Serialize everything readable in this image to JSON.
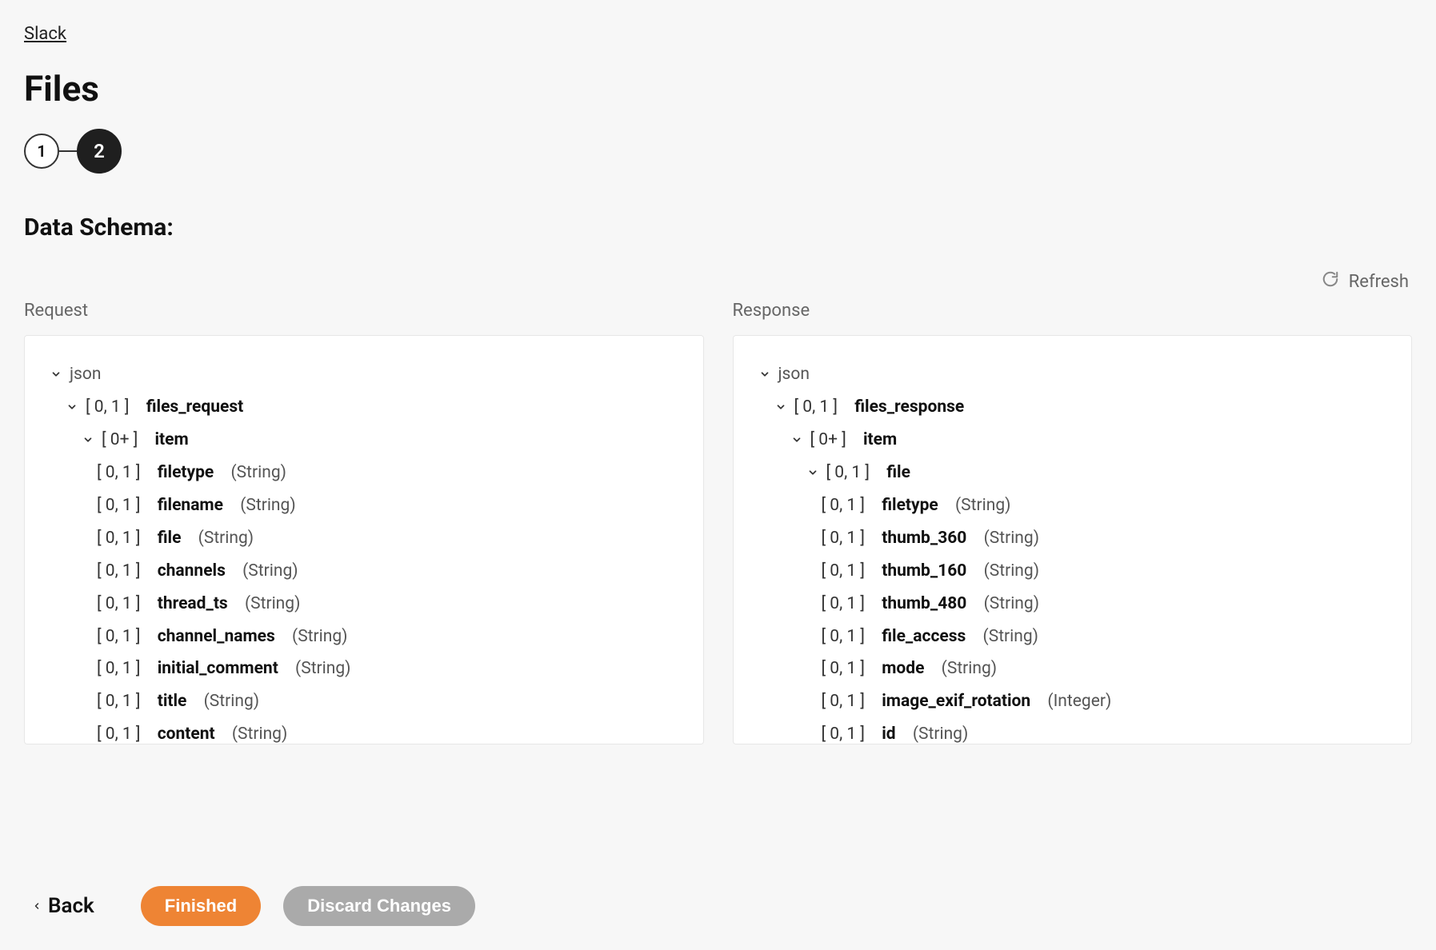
{
  "breadcrumb": "Slack",
  "title": "Files",
  "stepper": {
    "step1": "1",
    "step2": "2"
  },
  "section_title": "Data Schema:",
  "refresh_label": "Refresh",
  "columns": {
    "request_header": "Request",
    "response_header": "Response"
  },
  "tree": {
    "root_label": "json",
    "request": {
      "card": "[ 0, 1 ]",
      "name": "files_request",
      "item": {
        "card": "[ 0+ ]",
        "name": "item"
      },
      "fields": [
        {
          "card": "[ 0, 1 ]",
          "name": "filetype",
          "type": "(String)"
        },
        {
          "card": "[ 0, 1 ]",
          "name": "filename",
          "type": "(String)"
        },
        {
          "card": "[ 0, 1 ]",
          "name": "file",
          "type": "(String)"
        },
        {
          "card": "[ 0, 1 ]",
          "name": "channels",
          "type": "(String)"
        },
        {
          "card": "[ 0, 1 ]",
          "name": "thread_ts",
          "type": "(String)"
        },
        {
          "card": "[ 0, 1 ]",
          "name": "channel_names",
          "type": "(String)"
        },
        {
          "card": "[ 0, 1 ]",
          "name": "initial_comment",
          "type": "(String)"
        },
        {
          "card": "[ 0, 1 ]",
          "name": "title",
          "type": "(String)"
        },
        {
          "card": "[ 0, 1 ]",
          "name": "content",
          "type": "(String)"
        }
      ]
    },
    "response": {
      "card": "[ 0, 1 ]",
      "name": "files_response",
      "item": {
        "card": "[ 0+ ]",
        "name": "item"
      },
      "file": {
        "card": "[ 0, 1 ]",
        "name": "file"
      },
      "fields": [
        {
          "card": "[ 0, 1 ]",
          "name": "filetype",
          "type": "(String)"
        },
        {
          "card": "[ 0, 1 ]",
          "name": "thumb_360",
          "type": "(String)"
        },
        {
          "card": "[ 0, 1 ]",
          "name": "thumb_160",
          "type": "(String)"
        },
        {
          "card": "[ 0, 1 ]",
          "name": "thumb_480",
          "type": "(String)"
        },
        {
          "card": "[ 0, 1 ]",
          "name": "file_access",
          "type": "(String)"
        },
        {
          "card": "[ 0, 1 ]",
          "name": "mode",
          "type": "(String)"
        },
        {
          "card": "[ 0, 1 ]",
          "name": "image_exif_rotation",
          "type": "(Integer)"
        },
        {
          "card": "[ 0, 1 ]",
          "name": "id",
          "type": "(String)"
        }
      ]
    }
  },
  "footer": {
    "back": "Back",
    "finished": "Finished",
    "discard": "Discard Changes"
  }
}
